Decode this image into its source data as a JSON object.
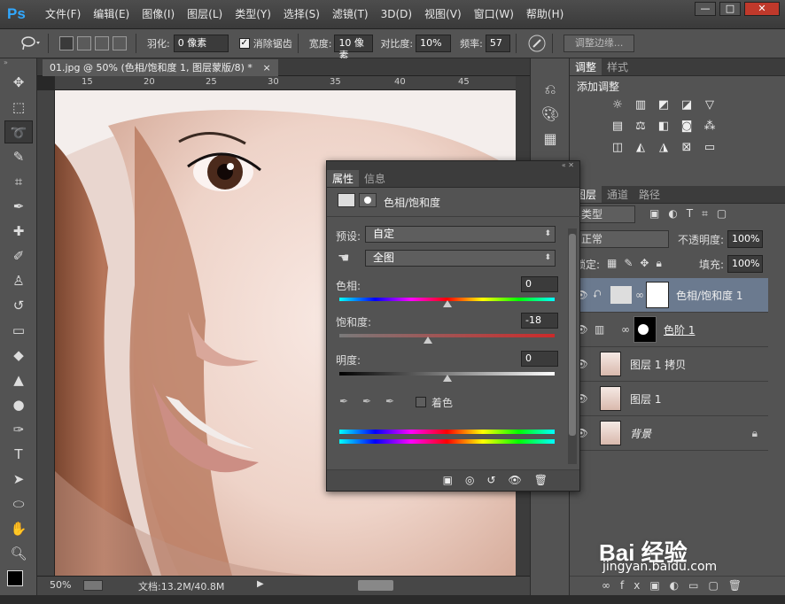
{
  "app": {
    "logo": "Ps"
  },
  "menu": [
    "文件(F)",
    "编辑(E)",
    "图像(I)",
    "图层(L)",
    "类型(Y)",
    "选择(S)",
    "滤镜(T)",
    "3D(D)",
    "视图(V)",
    "窗口(W)",
    "帮助(H)"
  ],
  "window_controls": {
    "minimize": "—",
    "restore": "□",
    "close": "✕"
  },
  "options_bar": {
    "feather_label": "羽化:",
    "feather_value": "0 像素",
    "antialias_label": "消除锯齿",
    "width_label": "宽度:",
    "width_value": "10 像素",
    "contrast_label": "对比度:",
    "contrast_value": "10%",
    "frequency_label": "频率:",
    "frequency_value": "57",
    "refine_edge_label": "调整边缘..."
  },
  "document": {
    "tab_title": "01.jpg @ 50% (色相/饱和度 1, 图层蒙版/8) *",
    "tab_close": "×",
    "ruler_ticks": [
      "15",
      "20",
      "25",
      "30",
      "35",
      "40",
      "45"
    ],
    "zoom": "50%",
    "doc_size": "文档:13.2M/40.8M"
  },
  "adjustments_panel": {
    "tabs": [
      "调整",
      "样式"
    ],
    "title": "添加调整"
  },
  "properties_panel": {
    "tabs": [
      "属性",
      "信息"
    ],
    "title": "色相/饱和度",
    "preset_label": "预设:",
    "preset_value": "自定",
    "channel_value": "全图",
    "hue_label": "色相:",
    "hue_value": "0",
    "saturation_label": "饱和度:",
    "saturation_value": "-18",
    "lightness_label": "明度:",
    "lightness_value": "0",
    "colorize_label": "着色",
    "saturation_fraction": 0.41,
    "hue_fraction": 0.5,
    "lightness_fraction": 0.5
  },
  "layers_panel": {
    "tabs": [
      "图层",
      "通道",
      "路径"
    ],
    "filter_label": "类型",
    "blend_mode": "正常",
    "opacity_label": "不透明度:",
    "opacity_value": "100%",
    "lock_label": "锁定:",
    "fill_label": "填充:",
    "fill_value": "100%",
    "layers": [
      {
        "name": "色相/饱和度 1",
        "selected": true
      },
      {
        "name": "色阶 1",
        "selected": false
      },
      {
        "name": "图层 1 拷贝",
        "selected": false
      },
      {
        "name": "图层 1",
        "selected": false
      },
      {
        "name": "背景",
        "selected": false
      }
    ]
  },
  "watermark": {
    "text": "Bai 经验",
    "sub": "jingyan.baidu.com"
  }
}
